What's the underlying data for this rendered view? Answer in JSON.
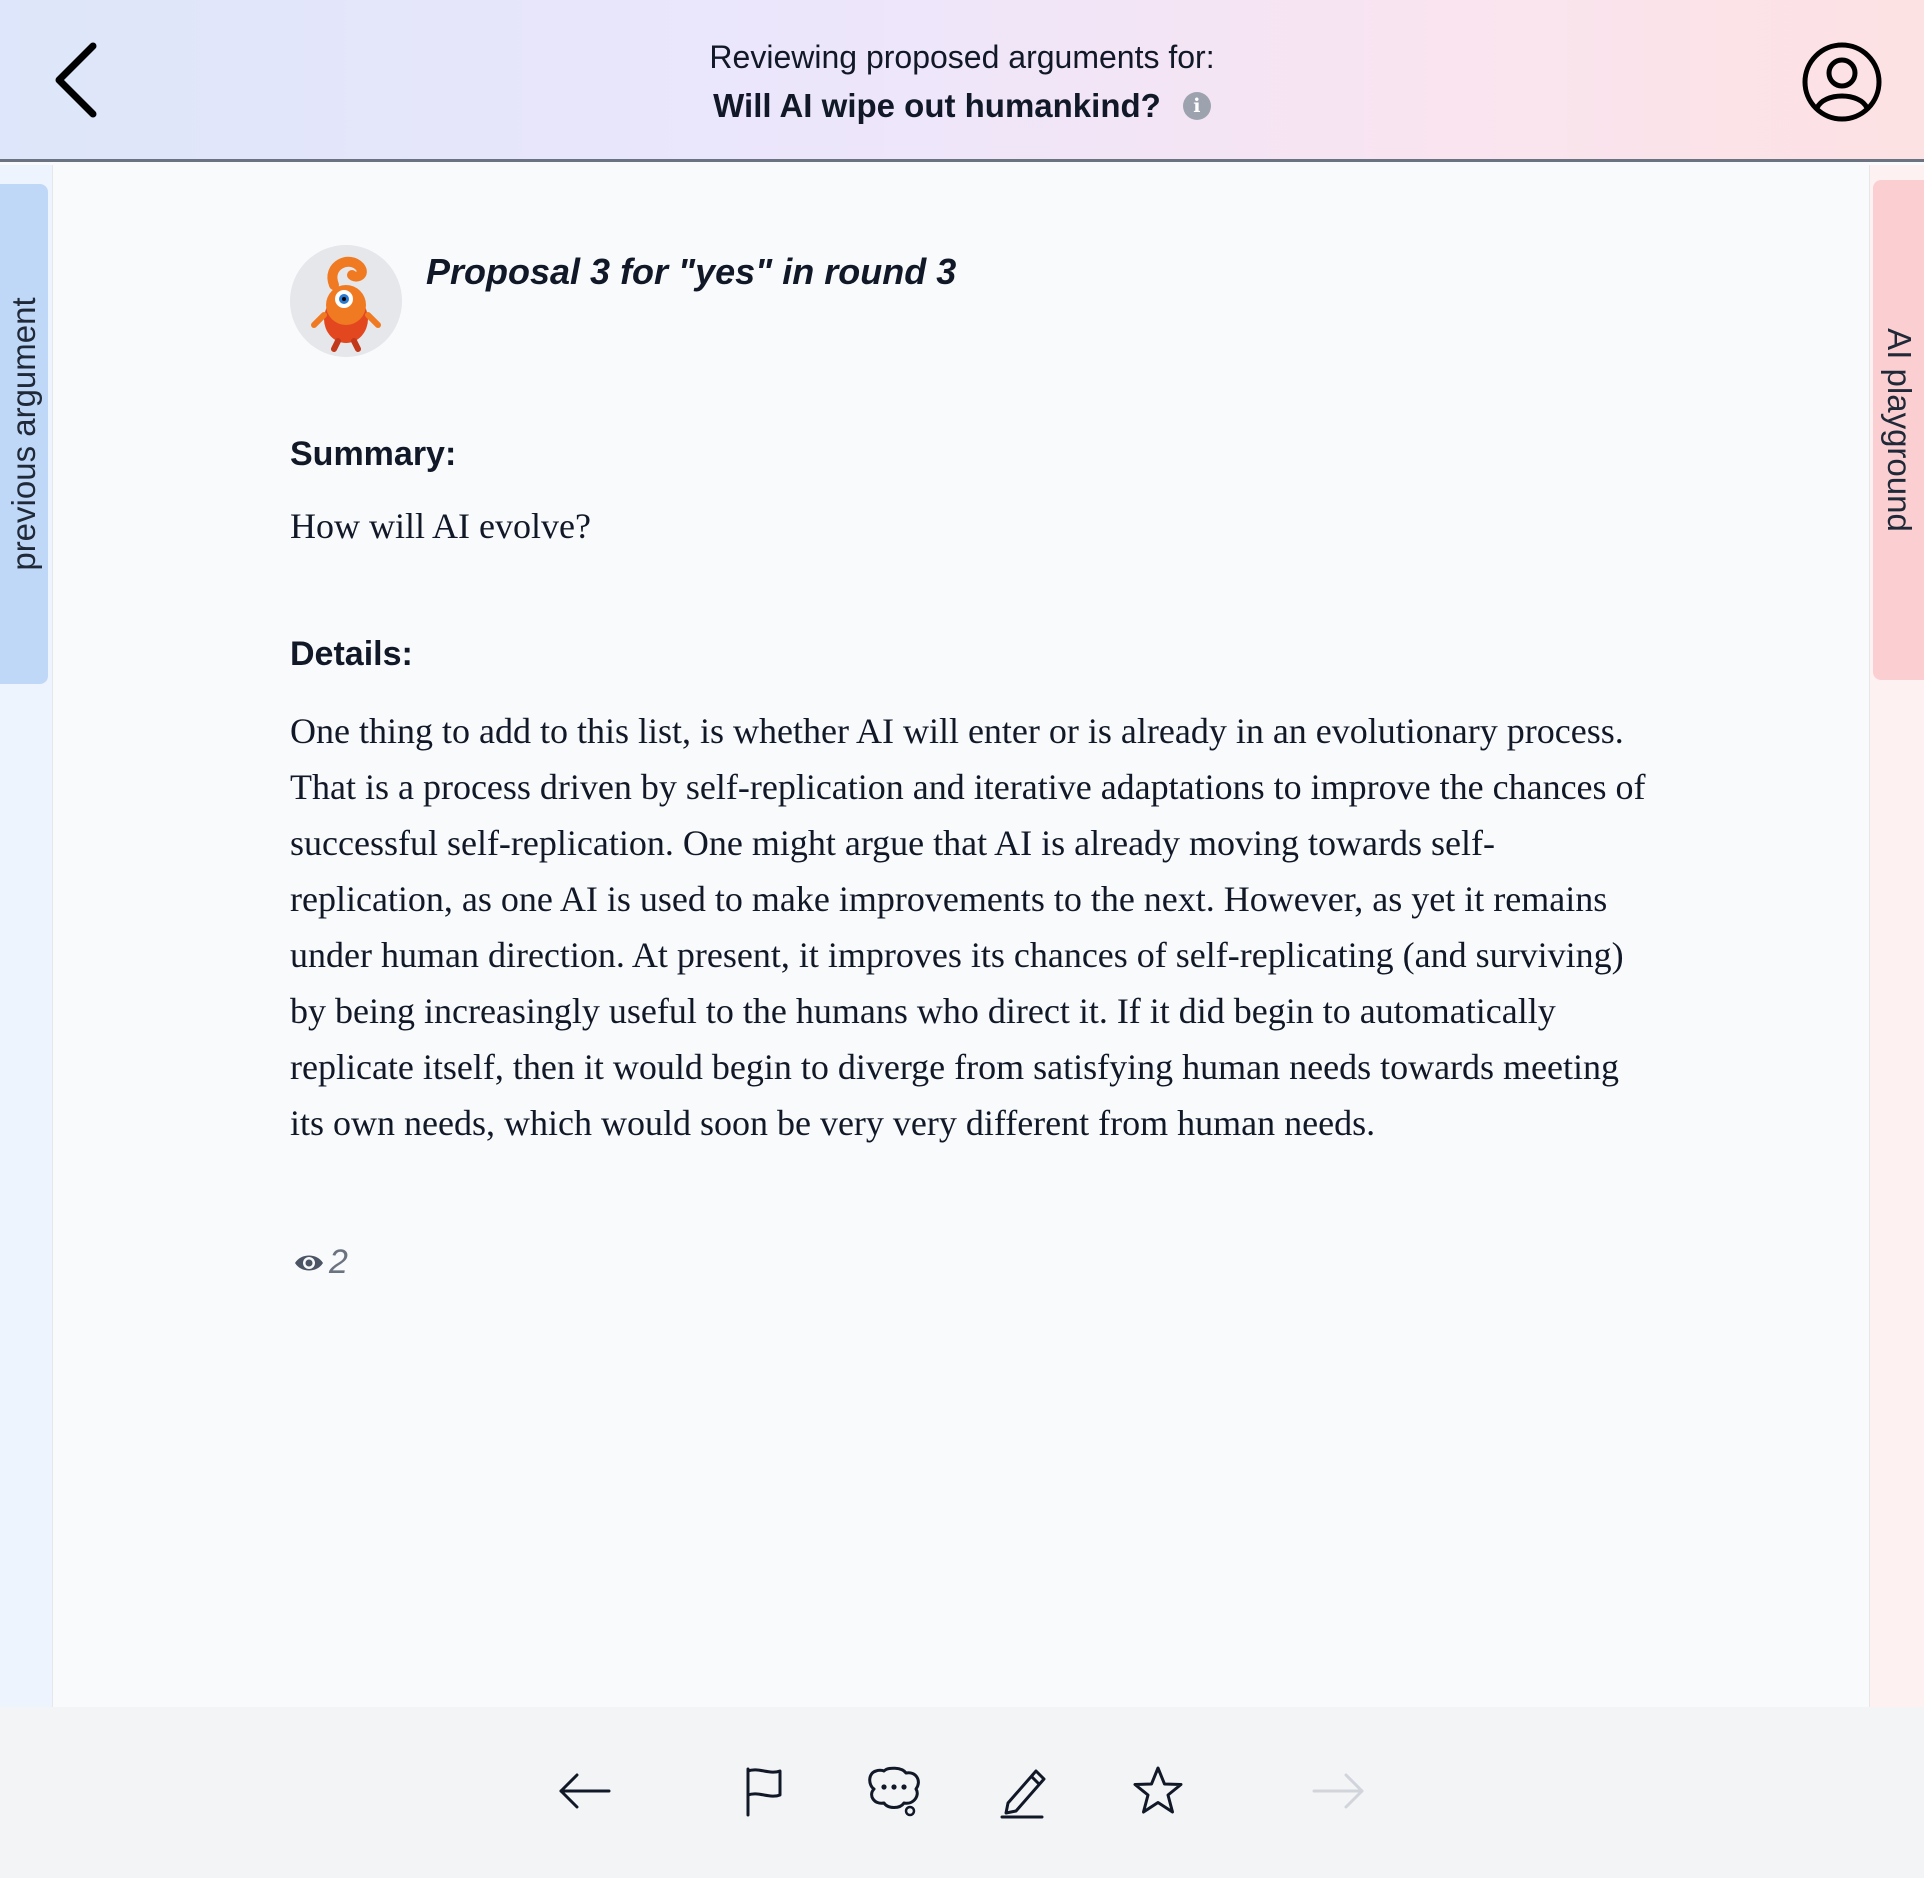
{
  "header": {
    "subtitle": "Reviewing proposed arguments for:",
    "title": "Will AI wipe out humankind?",
    "info_glyph": "i"
  },
  "side_tabs": {
    "left_label": "previous argument",
    "right_label": "AI playground"
  },
  "proposal": {
    "title": "Proposal 3 for \"yes\" in round 3",
    "summary_label": "Summary:",
    "summary": "How will AI evolve?",
    "details_label": "Details:",
    "details": "One thing to add to this list, is whether AI will enter or is already in an evolutionary process. That is a process driven by self-replication and iterative adaptations to improve the chances of successful self-replication. One might argue that AI is already moving towards self-replication, as one AI is used to make improvements to the next. However, as yet it remains under human direction. At present, it improves its chances of self-replicating (and surviving) by being increasingly useful to the humans who direct it. If it did begin to automatically replicate itself, then it would begin to diverge from satisfying human needs towards meeting its own needs, which would soon be very very different from human needs.",
    "view_count": "2"
  },
  "toolbar": {
    "icons": [
      "arrow-left-icon",
      "flag-icon",
      "comment-icon",
      "pencil-icon",
      "star-icon",
      "arrow-right-icon"
    ]
  },
  "colors": {
    "left_tab": "#c0d8f8",
    "right_tab": "#fbcfd2",
    "avatar_orange": "#f07a22"
  }
}
